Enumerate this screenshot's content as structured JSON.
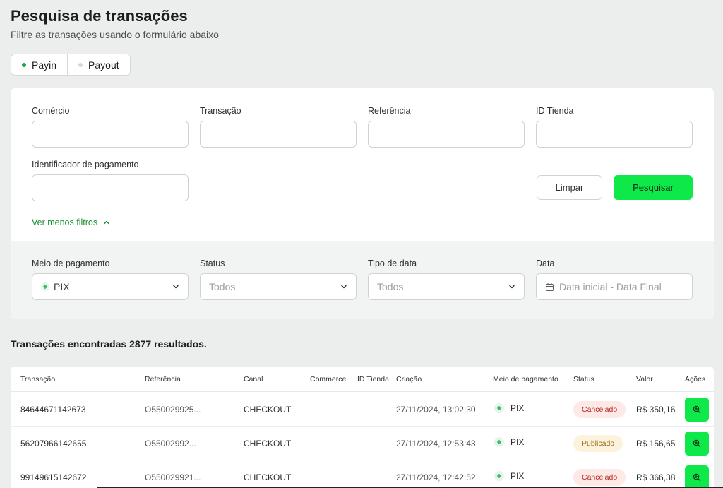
{
  "header": {
    "title": "Pesquisa de transações",
    "subtitle": "Filtre as transações usando o formulário abaixo"
  },
  "toggle": {
    "items": [
      {
        "label": "Payin",
        "active": true
      },
      {
        "label": "Payout",
        "active": false
      }
    ]
  },
  "filters": {
    "comercio": {
      "label": "Comércio",
      "value": ""
    },
    "transacao": {
      "label": "Transação",
      "value": ""
    },
    "referencia": {
      "label": "Referência",
      "value": ""
    },
    "id_tienda": {
      "label": "ID Tienda",
      "value": ""
    },
    "identificador": {
      "label": "Identificador de pagamento",
      "value": ""
    },
    "clear_label": "Limpar",
    "search_label": "Pesquisar",
    "less_filters_label": "Ver menos filtros",
    "meio_pagamento": {
      "label": "Meio de pagamento",
      "value": "PIX"
    },
    "status": {
      "label": "Status",
      "value": "Todos"
    },
    "tipo_data": {
      "label": "Tipo de data",
      "value": "Todos"
    },
    "data": {
      "label": "Data",
      "placeholder": "Data inicial - Data Final"
    }
  },
  "results": {
    "title": "Transações encontradas 2877 resultados."
  },
  "table": {
    "columns": [
      "Transação",
      "Referência",
      "Canal",
      "Commerce",
      "ID Tienda",
      "Criação",
      "Meio de pagamento",
      "Status",
      "Valor",
      "Ações"
    ],
    "rows": [
      {
        "transacao": "84644671142673",
        "referencia": "O550029925...",
        "canal": "CHECKOUT",
        "commerce": "",
        "id_tienda": "",
        "criacao": "27/11/2024, 13:02:30",
        "meio": "PIX",
        "status": "Cancelado",
        "valor": "R$ 350,16"
      },
      {
        "transacao": "56207966142655",
        "referencia": "O55002992...",
        "canal": "CHECKOUT",
        "commerce": "",
        "id_tienda": "",
        "criacao": "27/11/2024, 12:53:43",
        "meio": "PIX",
        "status": "Publicado",
        "valor": "R$ 156,65"
      },
      {
        "transacao": "99149615142672",
        "referencia": "O550029921...",
        "canal": "CHECKOUT",
        "commerce": "",
        "id_tienda": "",
        "criacao": "27/11/2024, 12:42:52",
        "meio": "PIX",
        "status": "Cancelado",
        "valor": "R$ 366,38"
      }
    ]
  },
  "colors": {
    "accent_green": "#0ee848",
    "link_green": "#17912f",
    "cancel_bg": "#fde9e6",
    "cancel_text": "#b42b20",
    "published_bg": "#fdf3dd",
    "published_text": "#9a6a12"
  },
  "icons": [
    "pix-icon",
    "chevron-down-icon",
    "chevron-up-icon",
    "calendar-icon",
    "zoom-in-icon"
  ]
}
